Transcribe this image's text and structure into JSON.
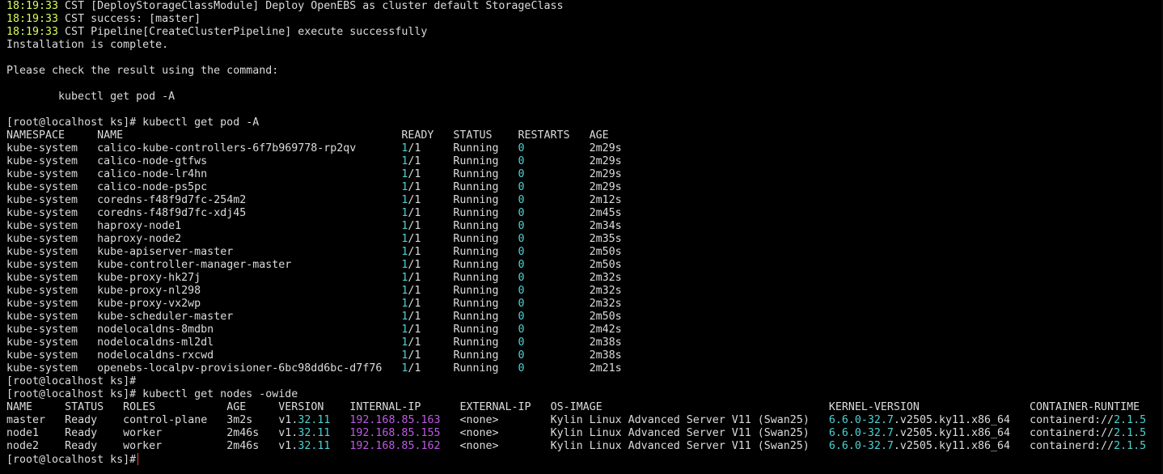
{
  "colors": {
    "background": "#000000",
    "text": "#dcdcdc",
    "timestamp": "#d7ff5a",
    "ready_count": "#4fd2d2",
    "restarts": "#4fd2d2",
    "ip": "#c05ae6",
    "version_num": "#4fd2d2",
    "cursor": "#ff3b3b"
  },
  "install_log": {
    "lines": [
      {
        "time": "18:19:33",
        "text": " CST [DeployStorageClassModule] Deploy OpenEBS as cluster default StorageClass"
      },
      {
        "time": "18:19:33",
        "text": " CST success: [master]"
      },
      {
        "time": "18:19:33",
        "text": " CST Pipeline[CreateClusterPipeline] execute successfully"
      }
    ],
    "complete_msg": "Installation is complete.",
    "check_msg": "Please check the result using the command:",
    "suggested_cmd": "        kubectl get pod -A"
  },
  "prompt": "[root@localhost ks]#",
  "cmd_get_pods": " kubectl get pod -A",
  "pods": {
    "headers": {
      "namespace": "NAMESPACE",
      "name": "NAME",
      "ready": "READY",
      "status": "STATUS",
      "restarts": "RESTARTS",
      "age": "AGE"
    },
    "rows": [
      {
        "namespace": "kube-system",
        "name": "calico-kube-controllers-6f7b969778-rp2qv",
        "ready_a": "1",
        "ready_b": "/1",
        "status": "Running",
        "restarts": "0",
        "age": "2m29s"
      },
      {
        "namespace": "kube-system",
        "name": "calico-node-gtfws",
        "ready_a": "1",
        "ready_b": "/1",
        "status": "Running",
        "restarts": "0",
        "age": "2m29s"
      },
      {
        "namespace": "kube-system",
        "name": "calico-node-lr4hn",
        "ready_a": "1",
        "ready_b": "/1",
        "status": "Running",
        "restarts": "0",
        "age": "2m29s"
      },
      {
        "namespace": "kube-system",
        "name": "calico-node-ps5pc",
        "ready_a": "1",
        "ready_b": "/1",
        "status": "Running",
        "restarts": "0",
        "age": "2m29s"
      },
      {
        "namespace": "kube-system",
        "name": "coredns-f48f9d7fc-254m2",
        "ready_a": "1",
        "ready_b": "/1",
        "status": "Running",
        "restarts": "0",
        "age": "2m12s"
      },
      {
        "namespace": "kube-system",
        "name": "coredns-f48f9d7fc-xdj45",
        "ready_a": "1",
        "ready_b": "/1",
        "status": "Running",
        "restarts": "0",
        "age": "2m45s"
      },
      {
        "namespace": "kube-system",
        "name": "haproxy-node1",
        "ready_a": "1",
        "ready_b": "/1",
        "status": "Running",
        "restarts": "0",
        "age": "2m34s"
      },
      {
        "namespace": "kube-system",
        "name": "haproxy-node2",
        "ready_a": "1",
        "ready_b": "/1",
        "status": "Running",
        "restarts": "0",
        "age": "2m35s"
      },
      {
        "namespace": "kube-system",
        "name": "kube-apiserver-master",
        "ready_a": "1",
        "ready_b": "/1",
        "status": "Running",
        "restarts": "0",
        "age": "2m50s"
      },
      {
        "namespace": "kube-system",
        "name": "kube-controller-manager-master",
        "ready_a": "1",
        "ready_b": "/1",
        "status": "Running",
        "restarts": "0",
        "age": "2m50s"
      },
      {
        "namespace": "kube-system",
        "name": "kube-proxy-hk27j",
        "ready_a": "1",
        "ready_b": "/1",
        "status": "Running",
        "restarts": "0",
        "age": "2m32s"
      },
      {
        "namespace": "kube-system",
        "name": "kube-proxy-nl298",
        "ready_a": "1",
        "ready_b": "/1",
        "status": "Running",
        "restarts": "0",
        "age": "2m32s"
      },
      {
        "namespace": "kube-system",
        "name": "kube-proxy-vx2wp",
        "ready_a": "1",
        "ready_b": "/1",
        "status": "Running",
        "restarts": "0",
        "age": "2m32s"
      },
      {
        "namespace": "kube-system",
        "name": "kube-scheduler-master",
        "ready_a": "1",
        "ready_b": "/1",
        "status": "Running",
        "restarts": "0",
        "age": "2m50s"
      },
      {
        "namespace": "kube-system",
        "name": "nodelocaldns-8mdbn",
        "ready_a": "1",
        "ready_b": "/1",
        "status": "Running",
        "restarts": "0",
        "age": "2m42s"
      },
      {
        "namespace": "kube-system",
        "name": "nodelocaldns-ml2dl",
        "ready_a": "1",
        "ready_b": "/1",
        "status": "Running",
        "restarts": "0",
        "age": "2m38s"
      },
      {
        "namespace": "kube-system",
        "name": "nodelocaldns-rxcwd",
        "ready_a": "1",
        "ready_b": "/1",
        "status": "Running",
        "restarts": "0",
        "age": "2m38s"
      },
      {
        "namespace": "kube-system",
        "name": "openebs-localpv-provisioner-6bc98dd6bc-d7f76",
        "ready_a": "1",
        "ready_b": "/1",
        "status": "Running",
        "restarts": "0",
        "age": "2m21s"
      }
    ]
  },
  "cmd_get_nodes": " kubectl get nodes -owide",
  "nodes": {
    "headers": {
      "name": "NAME",
      "status": "STATUS",
      "roles": "ROLES",
      "age": "AGE",
      "version": "VERSION",
      "internal_ip": "INTERNAL-IP",
      "external_ip": "EXTERNAL-IP",
      "os_image": "OS-IMAGE",
      "kernel": "KERNEL-VERSION",
      "runtime": "CONTAINER-RUNTIME"
    },
    "rows": [
      {
        "name": "master",
        "status": "Ready",
        "roles": "control-plane",
        "age": "3m2s",
        "version_a": "v1.",
        "version_b": "32.11",
        "internal_ip": "192.168.85.163",
        "external_ip": "<none>",
        "os_image": "Kylin Linux Advanced Server V11 (Swan25)",
        "kernel_a": "6.6.0-32.7",
        "kernel_b": ".v2505.ky11.x86_64",
        "runtime_a": "containerd://",
        "runtime_b": "2.1.5"
      },
      {
        "name": "node1",
        "status": "Ready",
        "roles": "worker",
        "age": "2m46s",
        "version_a": "v1.",
        "version_b": "32.11",
        "internal_ip": "192.168.85.155",
        "external_ip": "<none>",
        "os_image": "Kylin Linux Advanced Server V11 (Swan25)",
        "kernel_a": "6.6.0-32.7",
        "kernel_b": ".v2505.ky11.x86_64",
        "runtime_a": "containerd://",
        "runtime_b": "2.1.5"
      },
      {
        "name": "node2",
        "status": "Ready",
        "roles": "worker",
        "age": "2m46s",
        "version_a": "v1.",
        "version_b": "32.11",
        "internal_ip": "192.168.85.162",
        "external_ip": "<none>",
        "os_image": "Kylin Linux Advanced Server V11 (Swan25)",
        "kernel_a": "6.6.0-32.7",
        "kernel_b": ".v2505.ky11.x86_64",
        "runtime_a": "containerd://",
        "runtime_b": "2.1.5"
      }
    ]
  }
}
